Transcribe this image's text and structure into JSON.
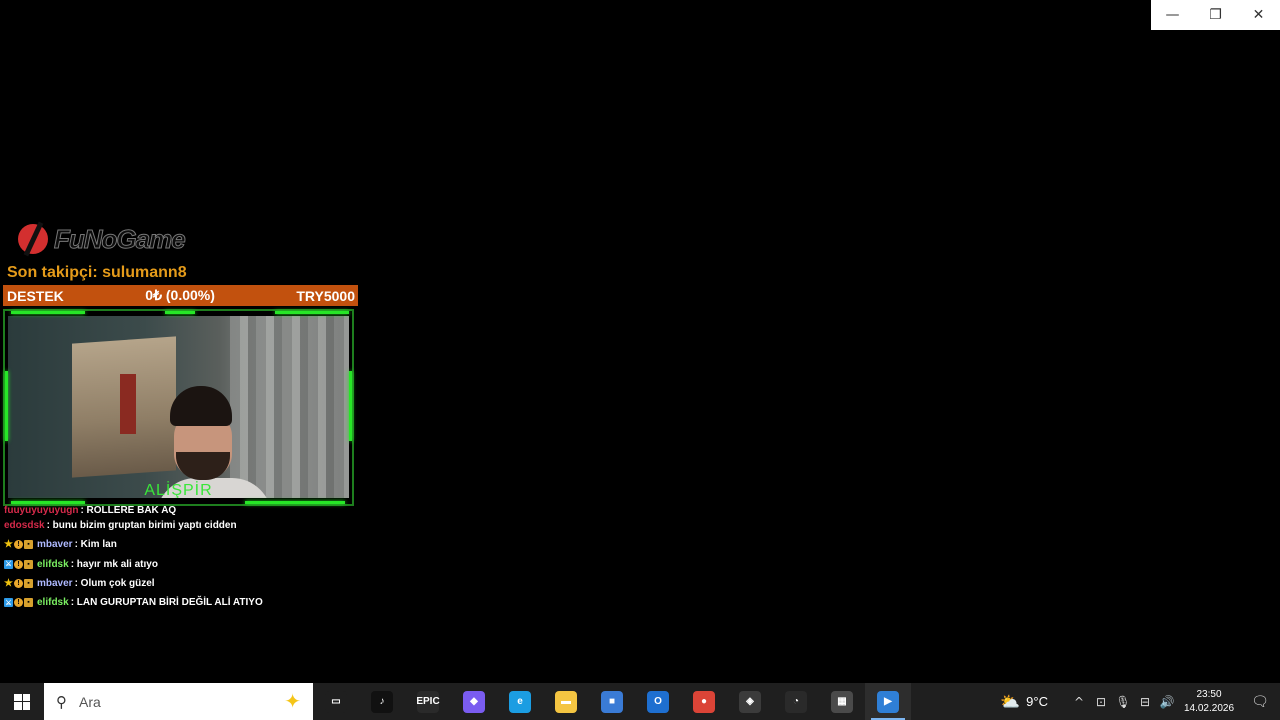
{
  "window_controls": {
    "minimize": "—",
    "restore": "❐",
    "close": "✕"
  },
  "overlay": {
    "logo_text": "FuNoGame",
    "last_follower": "Son takipçi: sulumann8",
    "support_bar": {
      "label": "DESTEK",
      "progress": "0₺ (0.00%)",
      "goal": "TRY5000",
      "progress_fraction": 0
    },
    "camera_name": "ALİŞPİR"
  },
  "chat": {
    "messages": [
      {
        "user": "fuuyuyuyuyugn",
        "user_color": "#d52a4a",
        "badges": [],
        "text": ": ROLLERE BAK AQ",
        "cut": true
      },
      {
        "user": "edosdsk",
        "user_color": "#d52a4a",
        "badges": [],
        "text": ": bunu bizim gruptan birimi yaptı cidden"
      },
      {
        "user": "mbaver",
        "user_color": "#aeb9ff",
        "badges": [
          "star-icon",
          "sub-badge-icon",
          "gift-badge-icon"
        ],
        "text": ": Kim lan"
      },
      {
        "user": "elifdsk",
        "user_color": "#7bf062",
        "badges": [
          "mod-icon",
          "sub-badge-icon",
          "gift-badge-icon"
        ],
        "text": ": hayır mk ali atıyo"
      },
      {
        "user": "mbaver",
        "user_color": "#aeb9ff",
        "badges": [
          "star-icon",
          "sub-badge-icon",
          "gift-badge-icon"
        ],
        "text": ": Olum çok güzel"
      },
      {
        "user": "elifdsk",
        "user_color": "#7bf062",
        "badges": [
          "mod-icon",
          "sub-badge-icon",
          "gift-badge-icon"
        ],
        "text": ": LAN GURUPTAN BİRİ DEĞİL ALİ ATIYO"
      }
    ]
  },
  "taskbar": {
    "search_placeholder": "Ara",
    "apps": [
      {
        "name": "task-view-icon",
        "label": "▭",
        "color": "#1f1f1f"
      },
      {
        "name": "tiktok-icon",
        "label": "♪",
        "color": "#111111"
      },
      {
        "name": "epic-games-icon",
        "label": "EPIC",
        "color": "#2a2a2a"
      },
      {
        "name": "copilot-icon",
        "label": "◆",
        "color": "#7a5cf0"
      },
      {
        "name": "edge-icon",
        "label": "e",
        "color": "#1b9de2"
      },
      {
        "name": "file-explorer-icon",
        "label": "▬",
        "color": "#f4c542"
      },
      {
        "name": "ms-store-icon",
        "label": "■",
        "color": "#3a7bd5"
      },
      {
        "name": "outlook-icon",
        "label": "O",
        "color": "#1e6fd0"
      },
      {
        "name": "chrome-icon",
        "label": "●",
        "color": "#db4437"
      },
      {
        "name": "davinci-icon",
        "label": "◈",
        "color": "#3b3b3b"
      },
      {
        "name": "speedometer-icon",
        "label": "◔",
        "color": "#2a2a2a"
      },
      {
        "name": "calculator-icon",
        "label": "▦",
        "color": "#4a4a4a"
      },
      {
        "name": "media-player-icon",
        "label": "▶",
        "color": "#2f7fd6",
        "active": true
      }
    ],
    "weather": {
      "temp": "9°C"
    },
    "tray_icons": [
      {
        "name": "chevron-up-icon",
        "glyph": "^"
      },
      {
        "name": "meet-now-icon",
        "glyph": "⊡"
      },
      {
        "name": "microphone-icon",
        "glyph": "🎙"
      },
      {
        "name": "network-icon",
        "glyph": "⊟"
      },
      {
        "name": "volume-icon",
        "glyph": "🔊"
      }
    ],
    "time": "23:50",
    "date": "14.02.2026",
    "notification_glyph": "🗨"
  }
}
